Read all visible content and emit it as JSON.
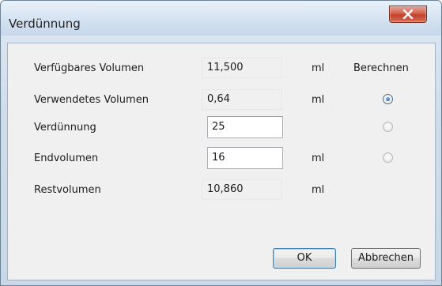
{
  "window": {
    "title": "Verdünnung",
    "close_icon": "close-x-icon"
  },
  "form": {
    "header_calculate": "Berechnen",
    "rows": [
      {
        "label": "Verfügbares Volumen",
        "value": "11,500",
        "unit": "ml",
        "editable": false,
        "radio": null
      },
      {
        "label": "Verwendetes Volumen",
        "value": "0,64",
        "unit": "ml",
        "editable": false,
        "radio": "checked"
      },
      {
        "label": "Verdünnung",
        "value": "25",
        "unit": "",
        "editable": true,
        "radio": "unchecked"
      },
      {
        "label": "Endvolumen",
        "value": "16",
        "unit": "ml",
        "editable": true,
        "radio": "unchecked"
      },
      {
        "label": "Restvolumen",
        "value": "10,860",
        "unit": "ml",
        "editable": false,
        "radio": null
      }
    ]
  },
  "buttons": {
    "ok_label": "OK",
    "cancel_label": "Abbrechen"
  },
  "colors": {
    "close_button": "#c7432c",
    "radio_selected": "#2a67b1"
  }
}
